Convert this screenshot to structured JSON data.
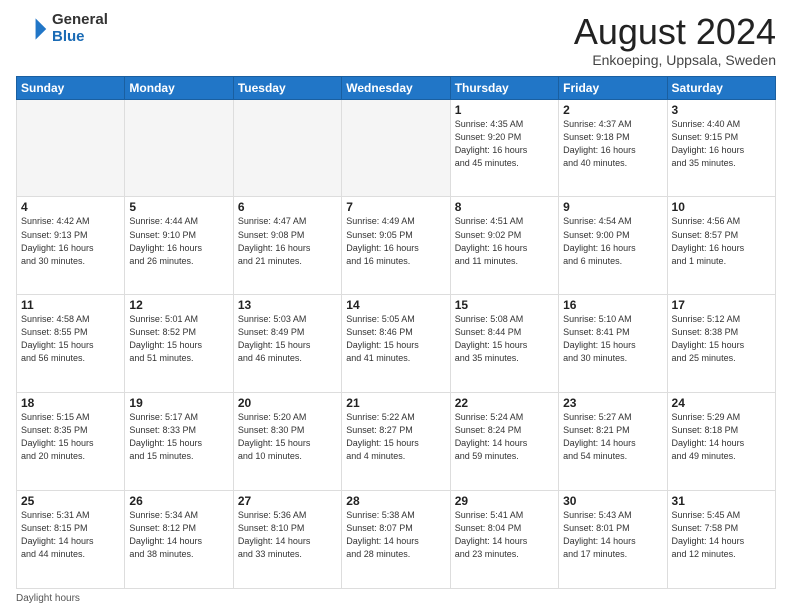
{
  "header": {
    "logo_general": "General",
    "logo_blue": "Blue",
    "main_title": "August 2024",
    "subtitle": "Enkoeping, Uppsala, Sweden"
  },
  "days_of_week": [
    "Sunday",
    "Monday",
    "Tuesday",
    "Wednesday",
    "Thursday",
    "Friday",
    "Saturday"
  ],
  "footer_note": "Daylight hours",
  "weeks": [
    [
      {
        "day": "",
        "info": ""
      },
      {
        "day": "",
        "info": ""
      },
      {
        "day": "",
        "info": ""
      },
      {
        "day": "",
        "info": ""
      },
      {
        "day": "1",
        "info": "Sunrise: 4:35 AM\nSunset: 9:20 PM\nDaylight: 16 hours\nand 45 minutes."
      },
      {
        "day": "2",
        "info": "Sunrise: 4:37 AM\nSunset: 9:18 PM\nDaylight: 16 hours\nand 40 minutes."
      },
      {
        "day": "3",
        "info": "Sunrise: 4:40 AM\nSunset: 9:15 PM\nDaylight: 16 hours\nand 35 minutes."
      }
    ],
    [
      {
        "day": "4",
        "info": "Sunrise: 4:42 AM\nSunset: 9:13 PM\nDaylight: 16 hours\nand 30 minutes."
      },
      {
        "day": "5",
        "info": "Sunrise: 4:44 AM\nSunset: 9:10 PM\nDaylight: 16 hours\nand 26 minutes."
      },
      {
        "day": "6",
        "info": "Sunrise: 4:47 AM\nSunset: 9:08 PM\nDaylight: 16 hours\nand 21 minutes."
      },
      {
        "day": "7",
        "info": "Sunrise: 4:49 AM\nSunset: 9:05 PM\nDaylight: 16 hours\nand 16 minutes."
      },
      {
        "day": "8",
        "info": "Sunrise: 4:51 AM\nSunset: 9:02 PM\nDaylight: 16 hours\nand 11 minutes."
      },
      {
        "day": "9",
        "info": "Sunrise: 4:54 AM\nSunset: 9:00 PM\nDaylight: 16 hours\nand 6 minutes."
      },
      {
        "day": "10",
        "info": "Sunrise: 4:56 AM\nSunset: 8:57 PM\nDaylight: 16 hours\nand 1 minute."
      }
    ],
    [
      {
        "day": "11",
        "info": "Sunrise: 4:58 AM\nSunset: 8:55 PM\nDaylight: 15 hours\nand 56 minutes."
      },
      {
        "day": "12",
        "info": "Sunrise: 5:01 AM\nSunset: 8:52 PM\nDaylight: 15 hours\nand 51 minutes."
      },
      {
        "day": "13",
        "info": "Sunrise: 5:03 AM\nSunset: 8:49 PM\nDaylight: 15 hours\nand 46 minutes."
      },
      {
        "day": "14",
        "info": "Sunrise: 5:05 AM\nSunset: 8:46 PM\nDaylight: 15 hours\nand 41 minutes."
      },
      {
        "day": "15",
        "info": "Sunrise: 5:08 AM\nSunset: 8:44 PM\nDaylight: 15 hours\nand 35 minutes."
      },
      {
        "day": "16",
        "info": "Sunrise: 5:10 AM\nSunset: 8:41 PM\nDaylight: 15 hours\nand 30 minutes."
      },
      {
        "day": "17",
        "info": "Sunrise: 5:12 AM\nSunset: 8:38 PM\nDaylight: 15 hours\nand 25 minutes."
      }
    ],
    [
      {
        "day": "18",
        "info": "Sunrise: 5:15 AM\nSunset: 8:35 PM\nDaylight: 15 hours\nand 20 minutes."
      },
      {
        "day": "19",
        "info": "Sunrise: 5:17 AM\nSunset: 8:33 PM\nDaylight: 15 hours\nand 15 minutes."
      },
      {
        "day": "20",
        "info": "Sunrise: 5:20 AM\nSunset: 8:30 PM\nDaylight: 15 hours\nand 10 minutes."
      },
      {
        "day": "21",
        "info": "Sunrise: 5:22 AM\nSunset: 8:27 PM\nDaylight: 15 hours\nand 4 minutes."
      },
      {
        "day": "22",
        "info": "Sunrise: 5:24 AM\nSunset: 8:24 PM\nDaylight: 14 hours\nand 59 minutes."
      },
      {
        "day": "23",
        "info": "Sunrise: 5:27 AM\nSunset: 8:21 PM\nDaylight: 14 hours\nand 54 minutes."
      },
      {
        "day": "24",
        "info": "Sunrise: 5:29 AM\nSunset: 8:18 PM\nDaylight: 14 hours\nand 49 minutes."
      }
    ],
    [
      {
        "day": "25",
        "info": "Sunrise: 5:31 AM\nSunset: 8:15 PM\nDaylight: 14 hours\nand 44 minutes."
      },
      {
        "day": "26",
        "info": "Sunrise: 5:34 AM\nSunset: 8:12 PM\nDaylight: 14 hours\nand 38 minutes."
      },
      {
        "day": "27",
        "info": "Sunrise: 5:36 AM\nSunset: 8:10 PM\nDaylight: 14 hours\nand 33 minutes."
      },
      {
        "day": "28",
        "info": "Sunrise: 5:38 AM\nSunset: 8:07 PM\nDaylight: 14 hours\nand 28 minutes."
      },
      {
        "day": "29",
        "info": "Sunrise: 5:41 AM\nSunset: 8:04 PM\nDaylight: 14 hours\nand 23 minutes."
      },
      {
        "day": "30",
        "info": "Sunrise: 5:43 AM\nSunset: 8:01 PM\nDaylight: 14 hours\nand 17 minutes."
      },
      {
        "day": "31",
        "info": "Sunrise: 5:45 AM\nSunset: 7:58 PM\nDaylight: 14 hours\nand 12 minutes."
      }
    ]
  ]
}
